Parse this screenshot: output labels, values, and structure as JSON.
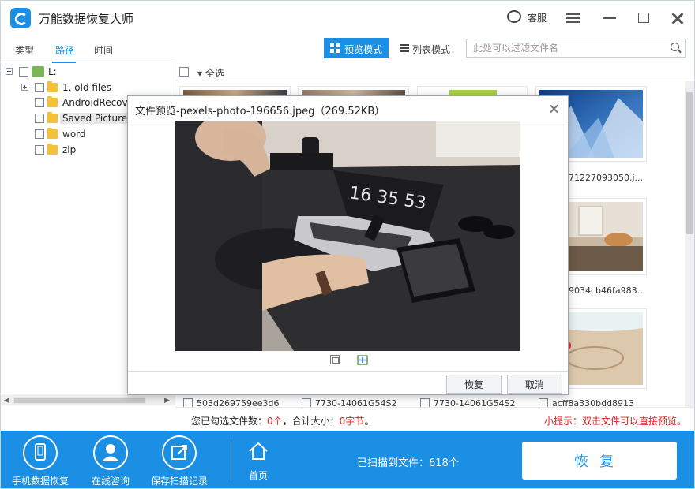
{
  "app": {
    "title": "万能数据恢复大师",
    "service_label": "客服"
  },
  "tabs": [
    {
      "label": "类型"
    },
    {
      "label": "路径"
    },
    {
      "label": "时间"
    }
  ],
  "toolbar": {
    "preview_mode": "预览模式",
    "list_mode": "列表模式",
    "search_placeholder": "此处可以过滤文件名"
  },
  "tree": {
    "root": "L:",
    "items": [
      {
        "label": "1. old files",
        "expandable": true
      },
      {
        "label": "AndroidRecov"
      },
      {
        "label": "Saved Pictures"
      },
      {
        "label": "word"
      },
      {
        "label": "zip"
      }
    ]
  },
  "grid": {
    "select_all": "全选",
    "right_column_names": [
      "71227093050.j...",
      "9034cb46fa983..."
    ],
    "bottom_row_names": [
      "503d269759ee3d6",
      "7730-14061G54S2",
      "7730-14061G54S2",
      "acff8a330bdd8913"
    ]
  },
  "status": {
    "selected_prefix": "您已勾选文件数：",
    "selected_count": "0个",
    "size_prefix": "，合计大小：",
    "size_value": "0字节",
    "size_suffix": "。",
    "tip": "小提示：双击文件可以直接预览。"
  },
  "bottom": {
    "phone_recovery": "手机数据恢复",
    "online_consult": "在线咨询",
    "save_scan": "保存扫描记录",
    "home": "首页",
    "scanned": "已扫描到文件：618个",
    "recover": "恢复"
  },
  "dialog": {
    "title": "文件预览-pexels-photo-196656.jpeg（269.52KB）",
    "recover": "恢复",
    "cancel": "取消",
    "laptop_clock": "16 35 53"
  },
  "colors": {
    "accent": "#1a8fe3",
    "warning": "#e02020"
  }
}
